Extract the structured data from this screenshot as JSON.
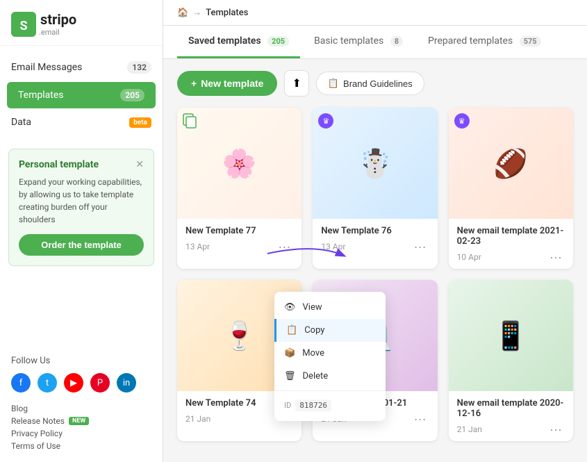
{
  "app": {
    "logo_text": "stripo",
    "logo_sub": ".email"
  },
  "sidebar": {
    "items": [
      {
        "label": "Email Messages",
        "badge": "132",
        "active": false
      },
      {
        "label": "Templates",
        "badge": "205",
        "active": true
      },
      {
        "label": "Data",
        "badge": "beta",
        "active": false
      }
    ]
  },
  "personal_template": {
    "title": "Personal template",
    "body": "Expand your working capabilities, by allowing us to take template creating burden off your shoulders",
    "button": "Order the template"
  },
  "follow": {
    "title": "Follow Us"
  },
  "footer_links": [
    {
      "label": "Blog",
      "new": false
    },
    {
      "label": "Release Notes",
      "new": true
    },
    {
      "label": "Privacy Policy",
      "new": false
    },
    {
      "label": "Terms of Use",
      "new": false
    }
  ],
  "breadcrumb": {
    "home": "🏠",
    "arrow": "→",
    "current": "Templates"
  },
  "tabs": [
    {
      "label": "Saved templates",
      "count": "205",
      "active": true
    },
    {
      "label": "Basic templates",
      "count": "8",
      "active": false
    },
    {
      "label": "Prepared templates",
      "count": "575",
      "active": false
    }
  ],
  "actions": {
    "new_template": "+ New template",
    "brand_guidelines": "Brand Guidelines"
  },
  "templates": [
    {
      "name": "New Template 77",
      "date": "13 Apr",
      "thumb": "1",
      "crown": false,
      "copy_icon": true
    },
    {
      "name": "New Template 76",
      "date": "13 Apr",
      "thumb": "2",
      "crown": true,
      "copy_icon": false
    },
    {
      "name": "New email template 2021-02-23",
      "date": "10 Apr",
      "thumb": "3",
      "crown": true,
      "copy_icon": false
    },
    {
      "name": "New Template 74",
      "date": "21 Jan",
      "thumb": "4",
      "crown": false,
      "copy_icon": false
    },
    {
      "name": "template 2021-01-21",
      "date": "21 Jan",
      "thumb": "5",
      "crown": false,
      "copy_icon": false
    },
    {
      "name": "New email template 2020-12-16",
      "date": "21 Jan",
      "thumb": "6",
      "crown": false,
      "copy_icon": false
    }
  ],
  "context_menu": {
    "items": [
      {
        "label": "View",
        "icon": "👁"
      },
      {
        "label": "Copy",
        "icon": "📋",
        "active": true
      },
      {
        "label": "Move",
        "icon": "📦"
      },
      {
        "label": "Delete",
        "icon": "🗑"
      }
    ],
    "id_label": "ID",
    "id_value": "818726"
  },
  "thumb_emojis": [
    "🌸",
    "☃️",
    "🏈",
    "🍷",
    "💻",
    "📱"
  ]
}
